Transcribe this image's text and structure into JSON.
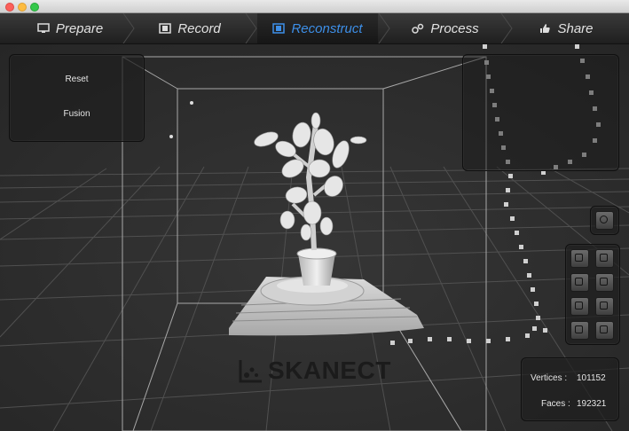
{
  "tabs": [
    {
      "label": "Prepare",
      "icon": "monitor-icon",
      "active": false
    },
    {
      "label": "Record",
      "icon": "film-icon",
      "active": false
    },
    {
      "label": "Reconstruct",
      "icon": "reconstruct-icon",
      "active": true
    },
    {
      "label": "Process",
      "icon": "gears-icon",
      "active": false
    },
    {
      "label": "Share",
      "icon": "thumbs-up-icon",
      "active": false
    }
  ],
  "left_panel": {
    "reset_label": "Reset",
    "fusion_label": "Fusion"
  },
  "stats": {
    "vertices_label": "Vertices :",
    "vertices_value": "101152",
    "faces_label": "Faces :",
    "faces_value": "192321"
  },
  "logo": {
    "text": "SKANECT"
  },
  "colors": {
    "accent": "#3d8fe8",
    "background": "#2f2f2f",
    "model": "#d9d9d9"
  }
}
